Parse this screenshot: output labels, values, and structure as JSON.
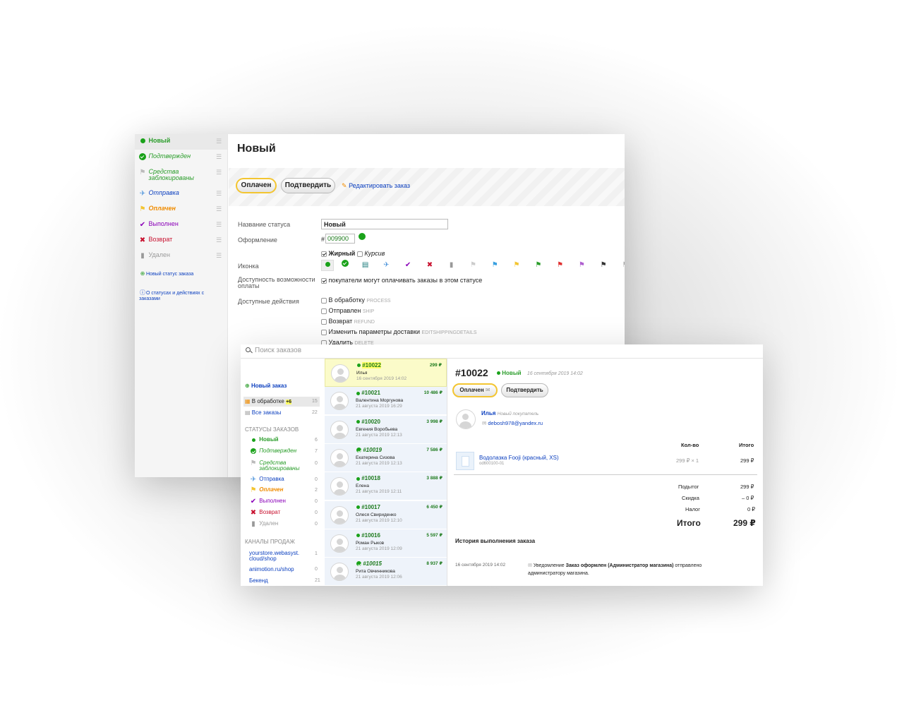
{
  "back": {
    "statuses": [
      {
        "label": "Новый",
        "cls": "g b",
        "icon": "dot"
      },
      {
        "label": "Подтвержден",
        "cls": "g it",
        "icon": "check-circle-icon"
      },
      {
        "label": "Средства заблокированы",
        "cls": "g it",
        "icon": "flag-white-icon"
      },
      {
        "label": "Отправка",
        "cls": "bl it",
        "icon": "plane-icon"
      },
      {
        "label": "Оплачен",
        "cls": "or it b",
        "icon": "flag-yellow-icon"
      },
      {
        "label": "Выполнен",
        "cls": "pu",
        "icon": "checkmark-icon"
      },
      {
        "label": "Возврат",
        "cls": "rd",
        "icon": "cross-icon"
      },
      {
        "label": "Удален",
        "cls": "gr",
        "icon": "trash-icon"
      }
    ],
    "new_status_link": "Новый статус заказа",
    "about_link": "О статусах и действиях с заказами",
    "title": "Новый",
    "btn_paid": "Оплачен",
    "btn_confirm": "Подтвердить",
    "edit_order": "Редактировать заказ",
    "form": {
      "name_label": "Название статуса",
      "name_value": "Новый",
      "style_label": "Оформление",
      "hash": "#",
      "color_value": "009900",
      "color": "#1aa21a",
      "bold": "Жирный",
      "italic": "Курсив",
      "icon_label": "Иконка",
      "pay_label": "Доступность возможности оплаты",
      "pay_text": "покупатели могут оплачивать заказы в этом статусе",
      "actions_label": "Доступные действия",
      "actions": [
        {
          "label": "В обработку",
          "code": "PROCESS"
        },
        {
          "label": "Отправлен",
          "code": "SHIP"
        },
        {
          "label": "Возврат",
          "code": "REFUND"
        },
        {
          "label": "Изменить параметры доставки",
          "code": "EDITSHIPPINGDETAILS"
        },
        {
          "label": "Удалить",
          "code": "DELETE"
        }
      ]
    }
  },
  "front": {
    "search_placeholder": "Поиск заказов",
    "new_order": "Новый заказ",
    "in_processing": "В обработке",
    "in_processing_badge": "+6",
    "in_processing_count": "15",
    "all_orders": "Все заказы",
    "all_orders_count": "22",
    "statuses_header": "СТАТУСЫ ЗАКАЗОВ",
    "statuses": [
      {
        "label": "Новый",
        "cls": "g b",
        "count": "6"
      },
      {
        "label": "Подтвержден",
        "cls": "g it",
        "count": "7"
      },
      {
        "label": "Средства заблокированы",
        "cls": "g it",
        "count": "0"
      },
      {
        "label": "Отправка",
        "cls": "bl",
        "count": "0"
      },
      {
        "label": "Оплачен",
        "cls": "or it b",
        "count": "2"
      },
      {
        "label": "Выполнен",
        "cls": "pu",
        "count": "0"
      },
      {
        "label": "Возврат",
        "cls": "rd",
        "count": "0"
      },
      {
        "label": "Удален",
        "cls": "gr",
        "count": "0"
      }
    ],
    "channels_header": "КАНАЛЫ ПРОДАЖ",
    "channels": [
      {
        "label": "yourstore.webasyst.cloud/shop",
        "count": "1"
      },
      {
        "label": "animotion.ru/shop",
        "count": "0"
      },
      {
        "label": "Бекенд",
        "count": "21"
      }
    ],
    "orders": [
      {
        "num": "#10022",
        "customer": "Илья",
        "date": "16 сентября 2019 14:02",
        "total": "299 ₽",
        "status": "dot"
      },
      {
        "num": "#10021",
        "customer": "Валентина Моргунова",
        "date": "21 августа 2019 16:29",
        "total": "10 486 ₽",
        "status": "dot"
      },
      {
        "num": "#10020",
        "customer": "Евгения Воробьева",
        "date": "21 августа 2019 12:13",
        "total": "3 998 ₽",
        "status": "dot"
      },
      {
        "num": "#10019",
        "customer": "Екатерина Сизова",
        "date": "21 августа 2019 12:13",
        "total": "7 586 ₽",
        "status": "check"
      },
      {
        "num": "#10018",
        "customer": "Елена",
        "date": "21 августа 2019 12:11",
        "total": "3 888 ₽",
        "status": "dot"
      },
      {
        "num": "#10017",
        "customer": "Олеся Свириденко",
        "date": "21 августа 2019 12:10",
        "total": "6 450 ₽",
        "status": "dot"
      },
      {
        "num": "#10016",
        "customer": "Роман Рыков",
        "date": "21 августа 2019 12:09",
        "total": "5 597 ₽",
        "status": "dot"
      },
      {
        "num": "#10015",
        "customer": "Рита Овчинникова",
        "date": "21 августа 2019 12:06",
        "total": "8 937 ₽",
        "status": "check"
      }
    ],
    "detail": {
      "num": "#10022",
      "status": "Новый",
      "date": "16 сентября 2019 14:02",
      "btn_paid": "Оплачен",
      "btn_confirm": "Подтвердить",
      "customer": "Илья",
      "customer_note": "Новый покупатель",
      "email": "debosh978@yandex.ru",
      "col_qty": "Кол-во",
      "col_total": "Итого",
      "item_name": "Водолазка Fooji (красный, XS)",
      "item_sku": "od600100-01",
      "item_price": "299 ₽",
      "item_x": "× 1",
      "item_total": "299 ₽",
      "subtotal_label": "Подытог",
      "subtotal": "299 ₽",
      "discount_label": "Скидка",
      "discount": "– 0 ₽",
      "tax_label": "Налог",
      "tax": "0 ₽",
      "total_label": "Итого",
      "total": "299 ₽",
      "history_title": "История выполнения заказа",
      "history_date": "16 сентября 2019 14:02",
      "history_p1": "Уведомление ",
      "history_b": "Заказ оформлен (Администратор магазина)",
      "history_p2": " отправлено",
      "history_line2": "администратору магазина."
    }
  }
}
